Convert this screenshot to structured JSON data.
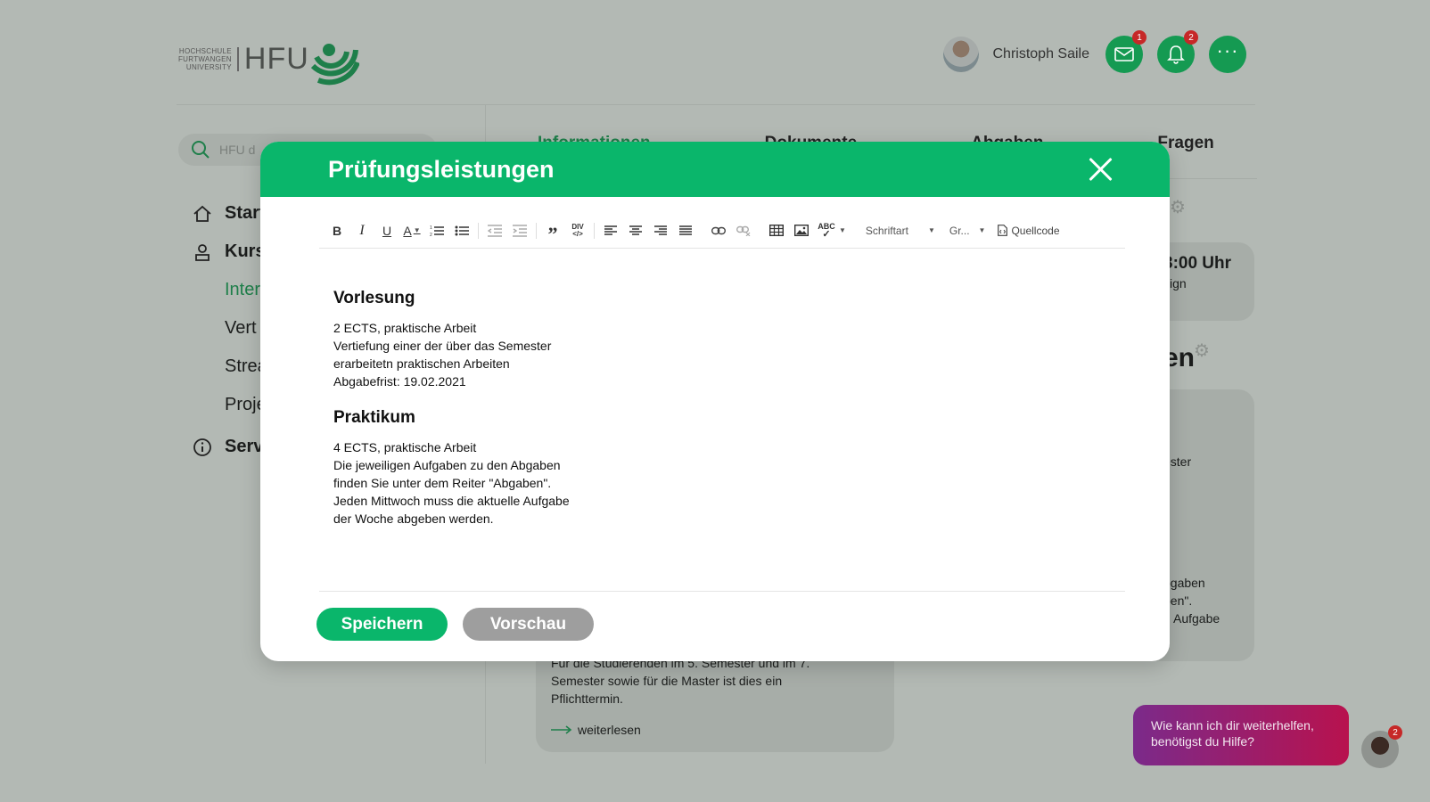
{
  "header": {
    "logo_small_lines": [
      "HOCHSCHULE",
      "FURTWANGEN",
      "UNIVERSITY"
    ],
    "logo_big": "HFU",
    "user_name": "Christoph Saile",
    "mail_badge": "1",
    "bell_badge": "2"
  },
  "search": {
    "placeholder": "HFU d"
  },
  "sidebar": {
    "items": [
      {
        "label": "Start",
        "icon": "home-icon"
      },
      {
        "label": "Kurs",
        "icon": "courses-icon"
      },
      {
        "label": "Inter",
        "sub": true,
        "active": true
      },
      {
        "label": "Vert",
        "sub": true
      },
      {
        "label": "Strea",
        "sub": true
      },
      {
        "label": "Proje",
        "sub": true
      },
      {
        "label": "Serv",
        "icon": "info-icon"
      }
    ]
  },
  "tabs": [
    "Informationen",
    "Dokumente",
    "Abgaben",
    "Fragen"
  ],
  "background": {
    "card_right_top": [
      "3:00 Uhr",
      "sign"
    ],
    "heading_partial": "en",
    "card_right_mid": "ester",
    "card_right_bottom": [
      "bgaben",
      "ben\".",
      "Aufgabe"
    ],
    "card_bottom_lines": [
      "Für die Studierenden im 5. Semester und im 7.",
      "Semester sowie für die Master ist dies ein",
      "Pflichttermin."
    ],
    "read_more": "weiterlesen",
    "help_text": "Wie kann ich dir weiterhelfen, benötigst du Hilfe?",
    "help_badge": "2"
  },
  "modal": {
    "title": "Prüfungsleistungen",
    "toolbar": {
      "font_label": "Schriftart",
      "size_label": "Gr...",
      "source_label": "Quellcode"
    },
    "sections": [
      {
        "heading": "Vorlesung",
        "lines": [
          "2 ECTS, praktische Arbeit",
          "Vertiefung einer der über das Semester",
          "erarbeitetn praktischen Arbeiten",
          "Abgabefrist: 19.02.2021"
        ]
      },
      {
        "heading": "Praktikum",
        "lines": [
          "4 ECTS, praktische Arbeit",
          "Die jeweiligen Aufgaben zu den Abgaben",
          "finden Sie unter dem Reiter \"Abgaben\".",
          "Jeden Mittwoch muss die aktuelle Aufgabe",
          "der Woche abgeben werden."
        ]
      }
    ],
    "save_label": "Speichern",
    "preview_label": "Vorschau"
  },
  "colors": {
    "accent_green": "#0ab66b",
    "dim_background": "#b3b9b4",
    "badge_red": "#c62828",
    "help_gradient_start": "#7b2a8a",
    "help_gradient_end": "#b8124e"
  }
}
